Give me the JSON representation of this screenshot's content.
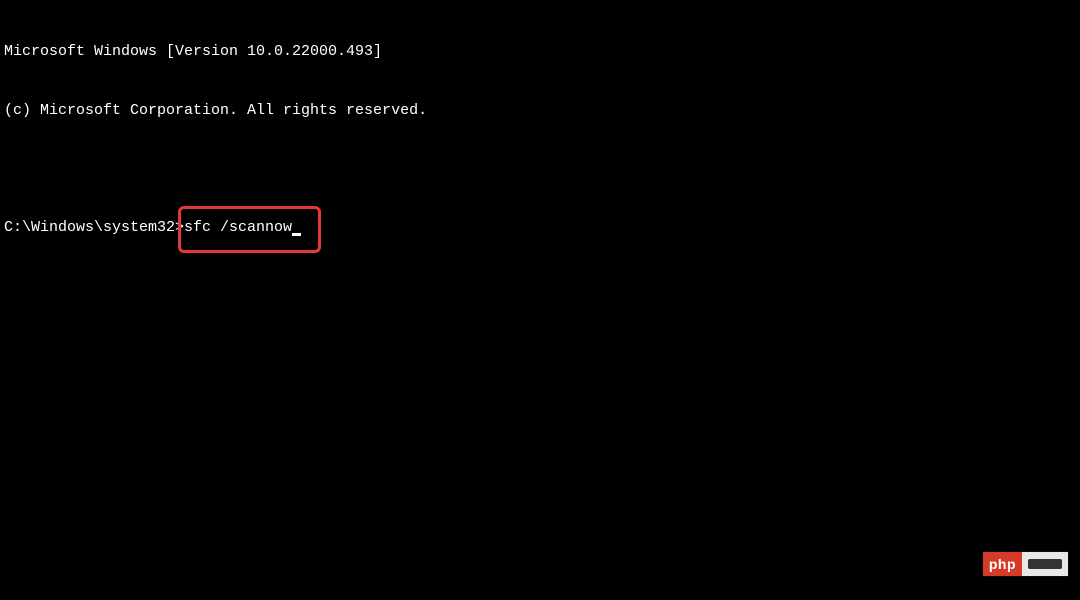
{
  "terminal": {
    "header_line1": "Microsoft Windows [Version 10.0.22000.493]",
    "header_line2": "(c) Microsoft Corporation. All rights reserved.",
    "prompt": "C:\\Windows\\system32>",
    "command": "sfc /scannow"
  },
  "watermark": {
    "left_text": "php"
  }
}
